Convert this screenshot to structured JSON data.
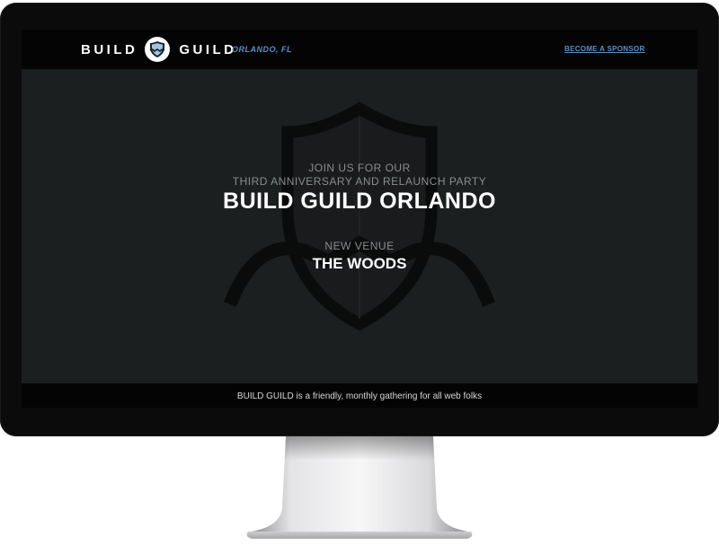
{
  "header": {
    "brand_left": "BUILD",
    "brand_right": "GUILD",
    "location": "ORLANDO, FL",
    "sponsor_link": "BECOME A SPONSOR"
  },
  "hero": {
    "kicker_line1": "JOIN US FOR OUR",
    "kicker_line2": "THIRD ANNIVERSARY AND RELAUNCH PARTY",
    "title": "BUILD GUILD ORLANDO",
    "venue_kicker": "NEW VENUE",
    "venue_name": "THE WOODS"
  },
  "footer": {
    "tagline": "BUILD GUILD is a friendly, monthly gathering for all web folks"
  },
  "icons": [
    "shield-logo-icon",
    "shield-watermark-icon"
  ],
  "colors": {
    "link": "#5b8fc9",
    "hero_bg": "#1c1f20",
    "header_bg": "#040405",
    "monitor_bezel": "#0b0b0c"
  }
}
